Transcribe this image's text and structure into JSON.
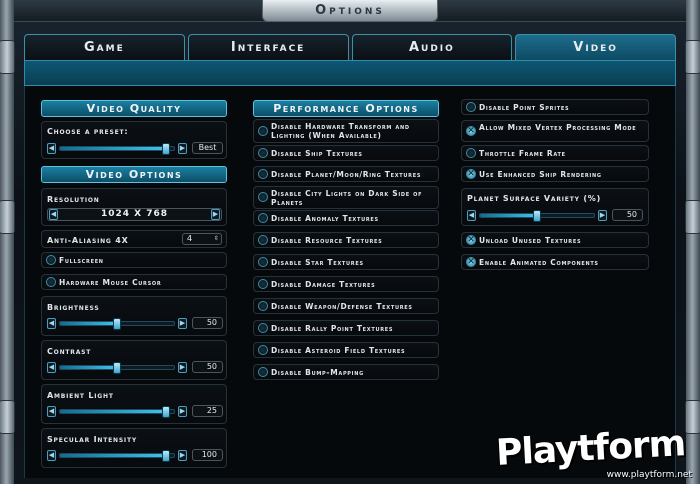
{
  "window": {
    "title": "Options"
  },
  "tabs": [
    {
      "label": "Game",
      "active": false
    },
    {
      "label": "Interface",
      "active": false
    },
    {
      "label": "Audio",
      "active": false
    },
    {
      "label": "Video",
      "active": true
    }
  ],
  "video_quality": {
    "header": "Video Quality",
    "preset_label": "Choose a preset:",
    "preset_value": "Best",
    "preset_level": 0.93
  },
  "video_options": {
    "header": "Video Options",
    "resolution_label": "Resolution",
    "resolution_value": "1024 X 768",
    "antialias_label": "Anti-Aliasing 4X",
    "antialias_value": "4",
    "fullscreen_label": "Fullscreen",
    "fullscreen_checked": false,
    "cursor_label": "Hardware Mouse Cursor",
    "cursor_checked": false,
    "sliders": [
      {
        "label": "Brightness",
        "value": "50",
        "level": 0.5
      },
      {
        "label": "Contrast",
        "value": "50",
        "level": 0.5
      },
      {
        "label": "Ambient Light",
        "value": "25",
        "level": 0.93
      },
      {
        "label": "Specular Intensity",
        "value": "100",
        "level": 0.93
      }
    ]
  },
  "performance": {
    "header": "Performance Options",
    "items": [
      {
        "label": "Disable Hardware Transform and Lighting (When Available)",
        "checked": false
      },
      {
        "label": "Disable Ship Textures",
        "checked": false
      },
      {
        "label": "Disable Planet/Moon/Ring Textures",
        "checked": false
      },
      {
        "label": "Disable City Lights on Dark Side of Planets",
        "checked": false
      },
      {
        "label": "Disable Anomaly Textures",
        "checked": false
      },
      {
        "label": "Disable Resource Textures",
        "checked": false
      },
      {
        "label": "Disable Star Textures",
        "checked": false
      },
      {
        "label": "Disable Damage Textures",
        "checked": false
      },
      {
        "label": "Disable Weapon/Defense Textures",
        "checked": false
      },
      {
        "label": "Disable Rally Point Textures",
        "checked": false
      },
      {
        "label": "Disable Asteroid Field Textures",
        "checked": false
      },
      {
        "label": "Disable Bump-Mapping",
        "checked": false
      }
    ]
  },
  "right_column": {
    "items_top": [
      {
        "label": "Disable Point Sprites",
        "checked": false
      },
      {
        "label": "Allow Mixed Vertex Processing Mode",
        "checked": true
      },
      {
        "label": "Throttle Frame Rate",
        "checked": false
      },
      {
        "label": "Use Enhanced Ship Rendering",
        "checked": true
      }
    ],
    "planet_variety_label": "Planet Surface Variety (%)",
    "planet_variety_value": "50",
    "planet_variety_level": 0.5,
    "items_bottom": [
      {
        "label": "Unload Unused Textures",
        "checked": true
      },
      {
        "label": "Enable Animated Components",
        "checked": true
      }
    ]
  },
  "watermark": {
    "logo": "Playtform",
    "url": "www.playtform.net"
  }
}
